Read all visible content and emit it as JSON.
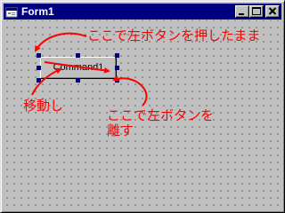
{
  "window": {
    "title": "Form1",
    "icon": "form-icon",
    "controls": {
      "minimize_icon": "minimize-icon",
      "maximize_icon": "maximize-icon",
      "close_icon": "close-icon"
    }
  },
  "form": {
    "command_button_label": "Command1"
  },
  "annotations": {
    "press_note": "ここで左ボタンを押したまま",
    "move_note": "移動し",
    "release_note_line1": "ここで左ボタンを",
    "release_note_line2": "離す",
    "color": "#ff0000"
  },
  "colors": {
    "titlebar": "#000080",
    "face": "#c0c0c0",
    "selection_handle": "#000080"
  }
}
